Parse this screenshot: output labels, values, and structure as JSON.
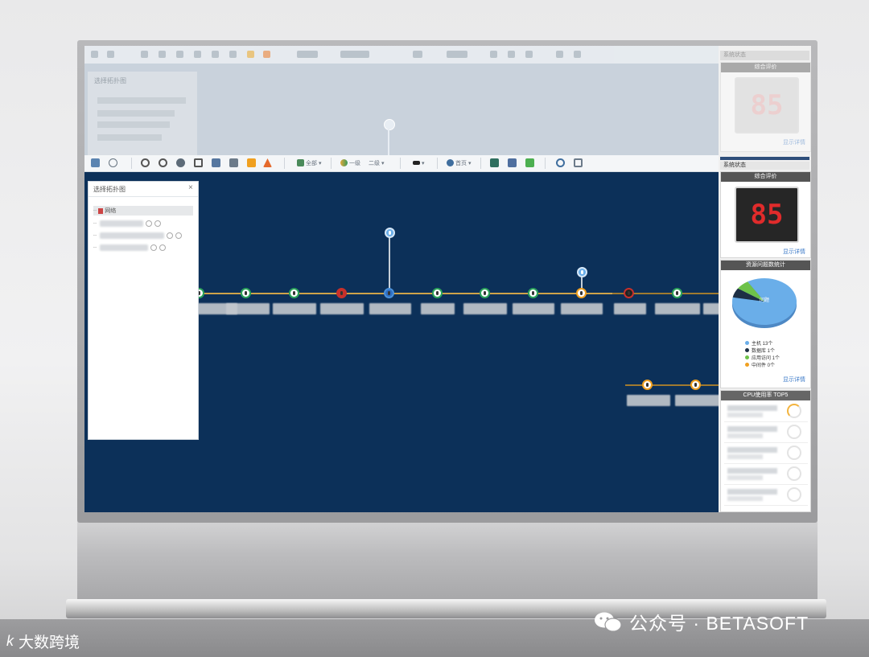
{
  "screen": {
    "health_score": "85",
    "health_score_ghost": "85"
  },
  "window": {
    "toolbar": {
      "filter_all": "全部",
      "level": "一级",
      "level_sub": "二级",
      "view": "首页"
    },
    "topo_panel": {
      "title": "选择拓扑图"
    },
    "ghost_panel": {
      "title": "选择拓扑图"
    },
    "tree": {
      "root": "网络"
    }
  },
  "right": {
    "title_ghost": "系统状态",
    "title": "系统状态",
    "health": {
      "header": "综合评价",
      "detail_link": "显示详情",
      "header_ghost": "综合评价",
      "detail_link_ghost": "显示详情"
    },
    "resource": {
      "header": "资源问题数统计",
      "pie_center": "问题",
      "legend": [
        "主机 13个",
        "数据库 1个",
        "应用访问 1个",
        "中间件 0个"
      ],
      "detail_link": "显示详情",
      "values": [
        13,
        1,
        1,
        0
      ]
    },
    "cpu": {
      "header": "CPU使用率 TOP5",
      "rows": 5
    }
  },
  "colors": {
    "main_bg": "#0c3059",
    "score_red": "#e02b2b",
    "pie": [
      "#6aaee9",
      "#1d2f45",
      "#6ec24a",
      "#f0a020"
    ],
    "link": "#cfa34a"
  },
  "watermark": {
    "brand": "公众号 · BETASOFT",
    "source": "大数跨境",
    "logo": "k"
  }
}
